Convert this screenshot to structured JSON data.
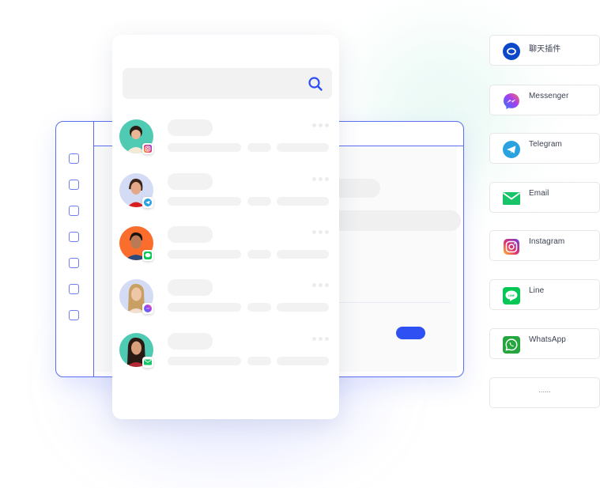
{
  "search": {
    "placeholder": "",
    "icon": "search-icon"
  },
  "contacts": [
    {
      "avatar_bg": "#4fcab3",
      "channel": "instagram",
      "badge_icon": "instagram-icon"
    },
    {
      "avatar_bg": "#d4dcf5",
      "channel": "telegram",
      "badge_icon": "telegram-icon"
    },
    {
      "avatar_bg": "#fb6d2c",
      "channel": "line",
      "badge_icon": "line-icon"
    },
    {
      "avatar_bg": "#d4dcf5",
      "channel": "messenger",
      "badge_icon": "messenger-icon"
    },
    {
      "avatar_bg": "#4fcab3",
      "channel": "email",
      "badge_icon": "email-icon"
    }
  ],
  "channels": [
    {
      "label": "聊天插件",
      "icon": "chat-widget-icon"
    },
    {
      "label": "Messenger",
      "icon": "messenger-icon"
    },
    {
      "label": "Telegram",
      "icon": "telegram-icon"
    },
    {
      "label": "Email",
      "icon": "email-icon"
    },
    {
      "label": "Instagram",
      "icon": "instagram-icon"
    },
    {
      "label": "Line",
      "icon": "line-icon"
    },
    {
      "label": "WhatsApp",
      "icon": "whatsapp-icon"
    },
    {
      "label": "......",
      "icon": ""
    }
  ],
  "colors": {
    "accent": "#2f50f2",
    "window_border": "#5b6ef0",
    "skeleton": "#f2f2f2"
  }
}
